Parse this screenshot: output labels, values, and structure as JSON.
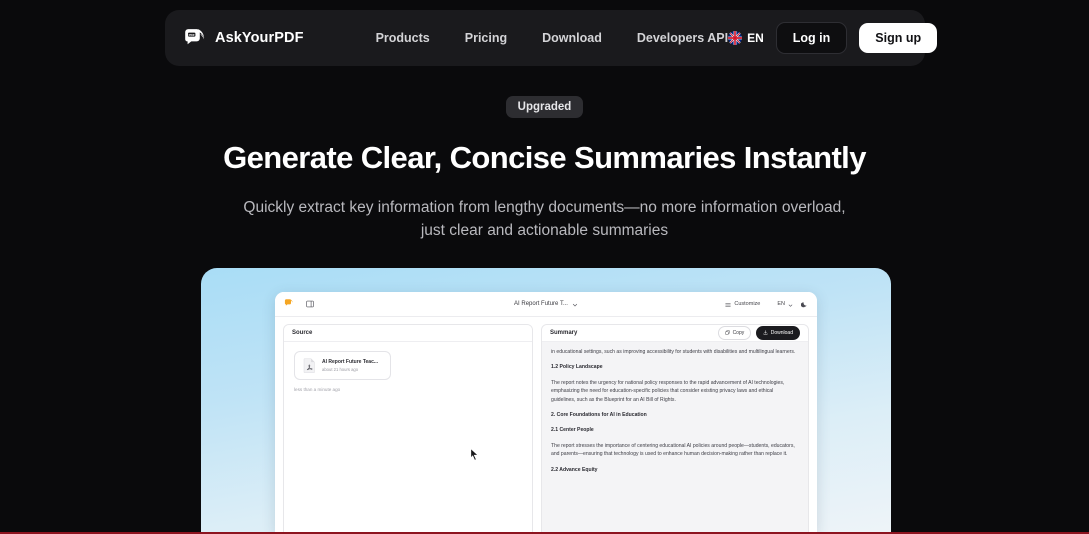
{
  "navbar": {
    "brand": "AskYourPDF",
    "links": [
      {
        "label": "Products"
      },
      {
        "label": "Pricing"
      },
      {
        "label": "Download"
      },
      {
        "label": "Developers API"
      }
    ],
    "language": "EN",
    "login_label": "Log in",
    "signup_label": "Sign up"
  },
  "hero": {
    "badge": "Upgraded",
    "title": "Generate Clear, Concise Summaries Instantly",
    "subtitle_line1": "Quickly extract key information from lengthy documents—no more information overload,",
    "subtitle_line2": "just clear and actionable summaries"
  },
  "app": {
    "toolbar": {
      "doc_title": "AI Report Future T...",
      "customize_label": "Customize",
      "language": "EN"
    },
    "source": {
      "panel_title": "Source",
      "file_name": "AI Report Future Teac...",
      "file_time": "about 21 hours ago",
      "uploaded_time": "less than a minute ago"
    },
    "summary": {
      "panel_title": "Summary",
      "copy_label": "Copy",
      "download_label": "Download",
      "blocks": [
        {
          "type": "p",
          "text": "in educational settings, such as improving accessibility for students with disabilities and multilingual learners."
        },
        {
          "type": "h",
          "text": "1.2 Policy Landscape"
        },
        {
          "type": "p",
          "text": "The report notes the urgency for national policy responses to the rapid advancement of AI technologies, emphasizing the need for education-specific policies that consider existing privacy laws and ethical guidelines, such as the Blueprint for an AI Bill of Rights."
        },
        {
          "type": "h",
          "text": "2. Core Foundations for AI in Education"
        },
        {
          "type": "h",
          "text": "2.1 Center People"
        },
        {
          "type": "p",
          "text": "The report stresses the importance of centering educational AI policies around people—students, educators, and parents—ensuring that technology is used to enhance human decision-making rather than replace it."
        },
        {
          "type": "h",
          "text": "2.2 Advance Equity"
        }
      ]
    }
  },
  "colors": {
    "page_background": "#0a0a0c",
    "navbar_background": "#1a1a1d",
    "accent_orange": "#f5a623",
    "mockup_gradient_top": "#a9ddf6",
    "loading_bar": "#8d1420"
  }
}
